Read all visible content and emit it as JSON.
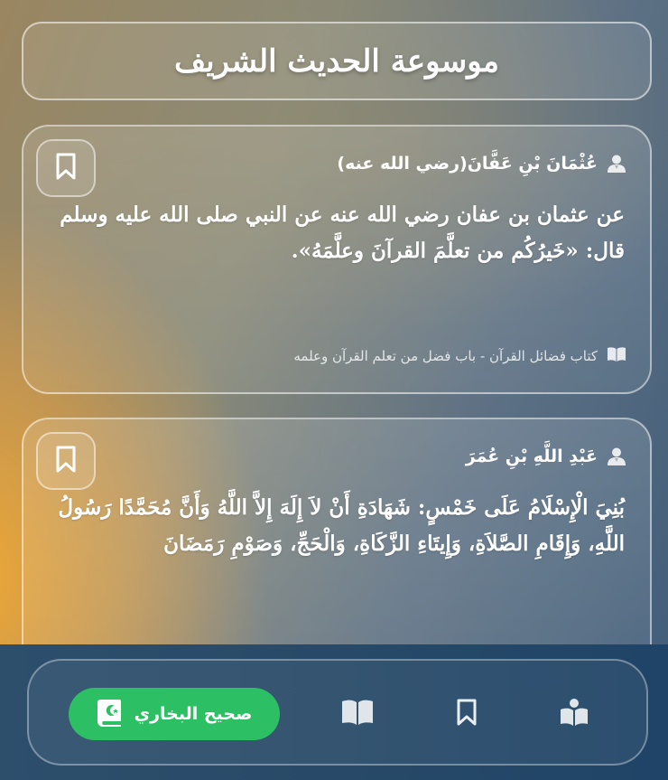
{
  "header": {
    "title": "موسوعة الحديث الشريف"
  },
  "hadiths": [
    {
      "narrator": "عُثْمَانَ بْنِ عَفَّانَ(رضي الله عنه)",
      "text": "عن عثمان بن عفان رضي الله عنه عن النبي صلى الله عليه وسلم قال: «خَيرُكُم من تعلَّمَ القرآنَ وعلَّمَهُ».",
      "source": "كتاب فضائل القرآن - باب فضل من تعلم القرآن وعلمه"
    },
    {
      "narrator": "عَبْدِ اللَّهِ بْنِ عُمَرَ",
      "text": "بُنِيَ الْإِسْلَامُ عَلَى خَمْسٍ: شَهَادَةِ أَنْ لاَ إِلَهَ إِلاَّ اللَّهُ وَأَنَّ مُحَمَّدًا رَسُولُ اللَّهِ، وَإِقَامِ الصَّلاَةِ، وَإِيتَاءِ الزَّكَاةِ، وَالْحَجِّ، وَصَوْمِ رَمَضَانَ"
    }
  ],
  "nav": {
    "active_label": "صحيح البخاري",
    "items": [
      "book-open-icon",
      "bookmark-icon",
      "reader-icon"
    ]
  },
  "colors": {
    "active_nav": "#2dbf64",
    "bottom_bar": "#284a68"
  }
}
